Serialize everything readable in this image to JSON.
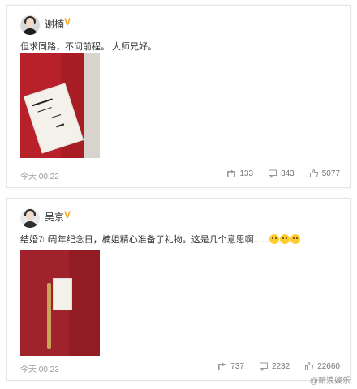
{
  "posts": [
    {
      "author": "谢楠",
      "verified_mark": "V",
      "text": "但求同路，不问前程。 大师兄好。",
      "time": "今天 00:22",
      "repost_count": "133",
      "comment_count": "343",
      "like_count": "5077"
    },
    {
      "author": "吴京",
      "verified_mark": "V",
      "text": "结婚7□周年纪念日，楠姐精心准备了礼物。这是几个意思啊......",
      "time": "今天 00:23",
      "repost_count": "737",
      "comment_count": "2232",
      "like_count": "22660"
    }
  ],
  "watermark": "@新浪娱乐",
  "colors": {
    "accent": "#f5a623",
    "muted": "#999999",
    "red": "#b8202a"
  }
}
